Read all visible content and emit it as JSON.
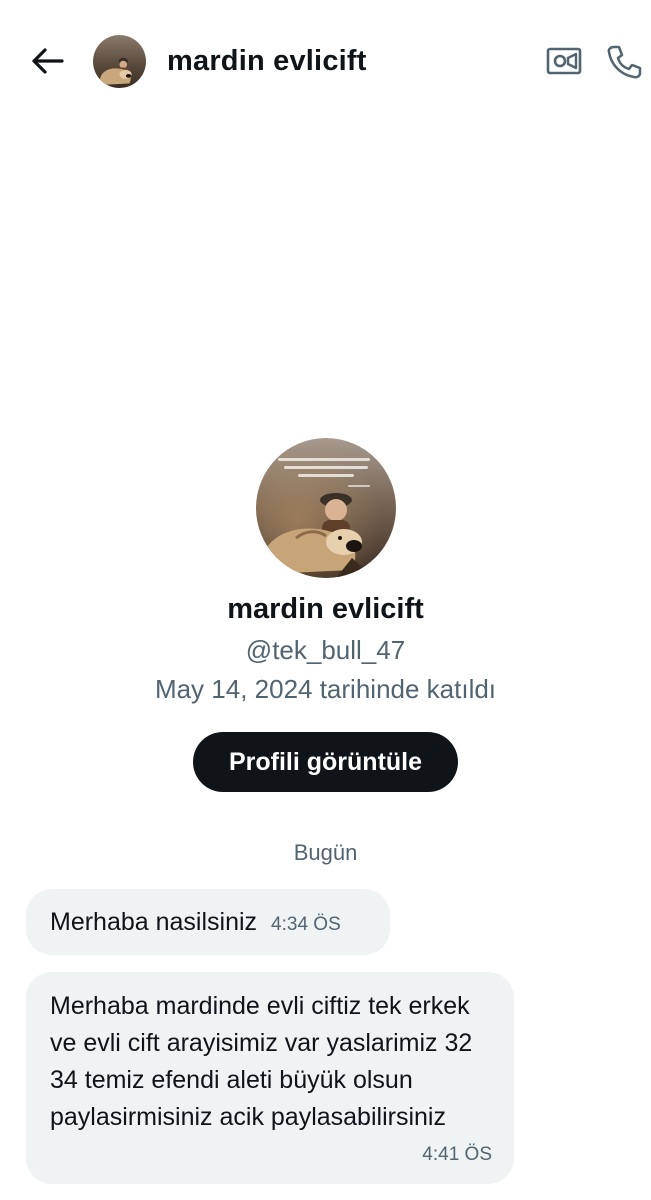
{
  "header": {
    "title": "mardin evlicift",
    "back_icon": "arrow-left-icon",
    "video_icon": "video-camera-icon",
    "call_icon": "phone-icon"
  },
  "profile": {
    "name": "mardin evlicift",
    "handle": "@tek_bull_47",
    "joined": "May 14, 2024 tarihinde katıldı",
    "view_profile_label": "Profili görüntüle"
  },
  "conversation": {
    "date_divider": "Bugün",
    "messages": [
      {
        "text": "Merhaba nasilsiniz",
        "time": "4:34 ÖS"
      },
      {
        "text": "Merhaba mardinde evli ciftiz tek erkek ve evli cift arayisimiz var yaslarimiz 32 34 temiz efendi aleti büyük olsun paylasirmisiniz acik paylasabilirsiniz",
        "time": "4:41 ÖS"
      }
    ]
  },
  "colors": {
    "text_primary": "#0f1419",
    "text_secondary": "#536471",
    "bubble_bg": "#eff3f4",
    "button_bg": "#0f1419",
    "button_text": "#ffffff"
  }
}
